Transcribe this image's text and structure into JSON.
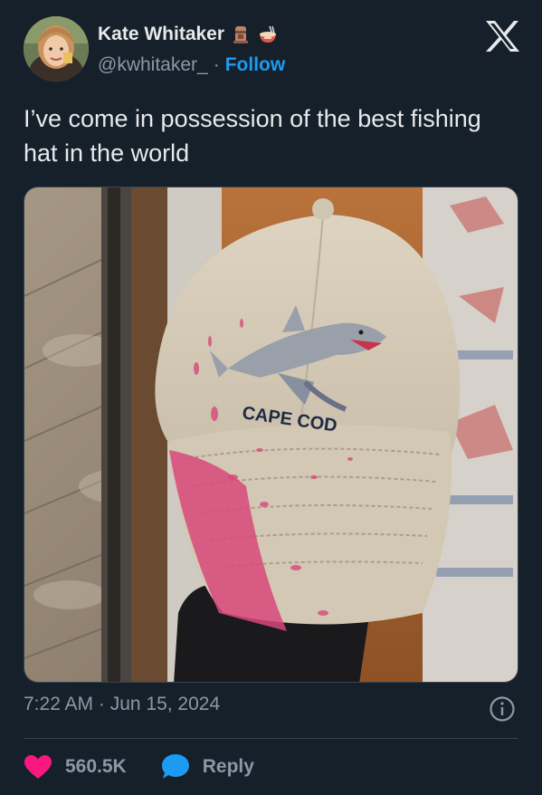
{
  "author": {
    "display_name": "Kate Whitaker",
    "handle": "@kwhitaker_",
    "separator": "·",
    "follow_label": "Follow",
    "badges": [
      "moai-emoji",
      "ramen-bowl-emoji"
    ]
  },
  "tweet": {
    "text": "I’ve come in possession of the best fishing hat in the world",
    "timestamp": "7:22 AM · Jun 15, 2024"
  },
  "media": {
    "hat_text": "CAPE COD",
    "description_icon": "shark-embroidered-cap-photo"
  },
  "actions": {
    "like_count": "560.5K",
    "reply_label": "Reply"
  },
  "colors": {
    "background": "#15202b",
    "text": "#e7e9ea",
    "muted": "#8b98a5",
    "accent": "#1d9bf0",
    "like": "#f91880"
  },
  "icons": {
    "platform": "x-logo-icon",
    "info": "info-icon",
    "like": "heart-icon",
    "reply": "speech-bubble-icon"
  }
}
